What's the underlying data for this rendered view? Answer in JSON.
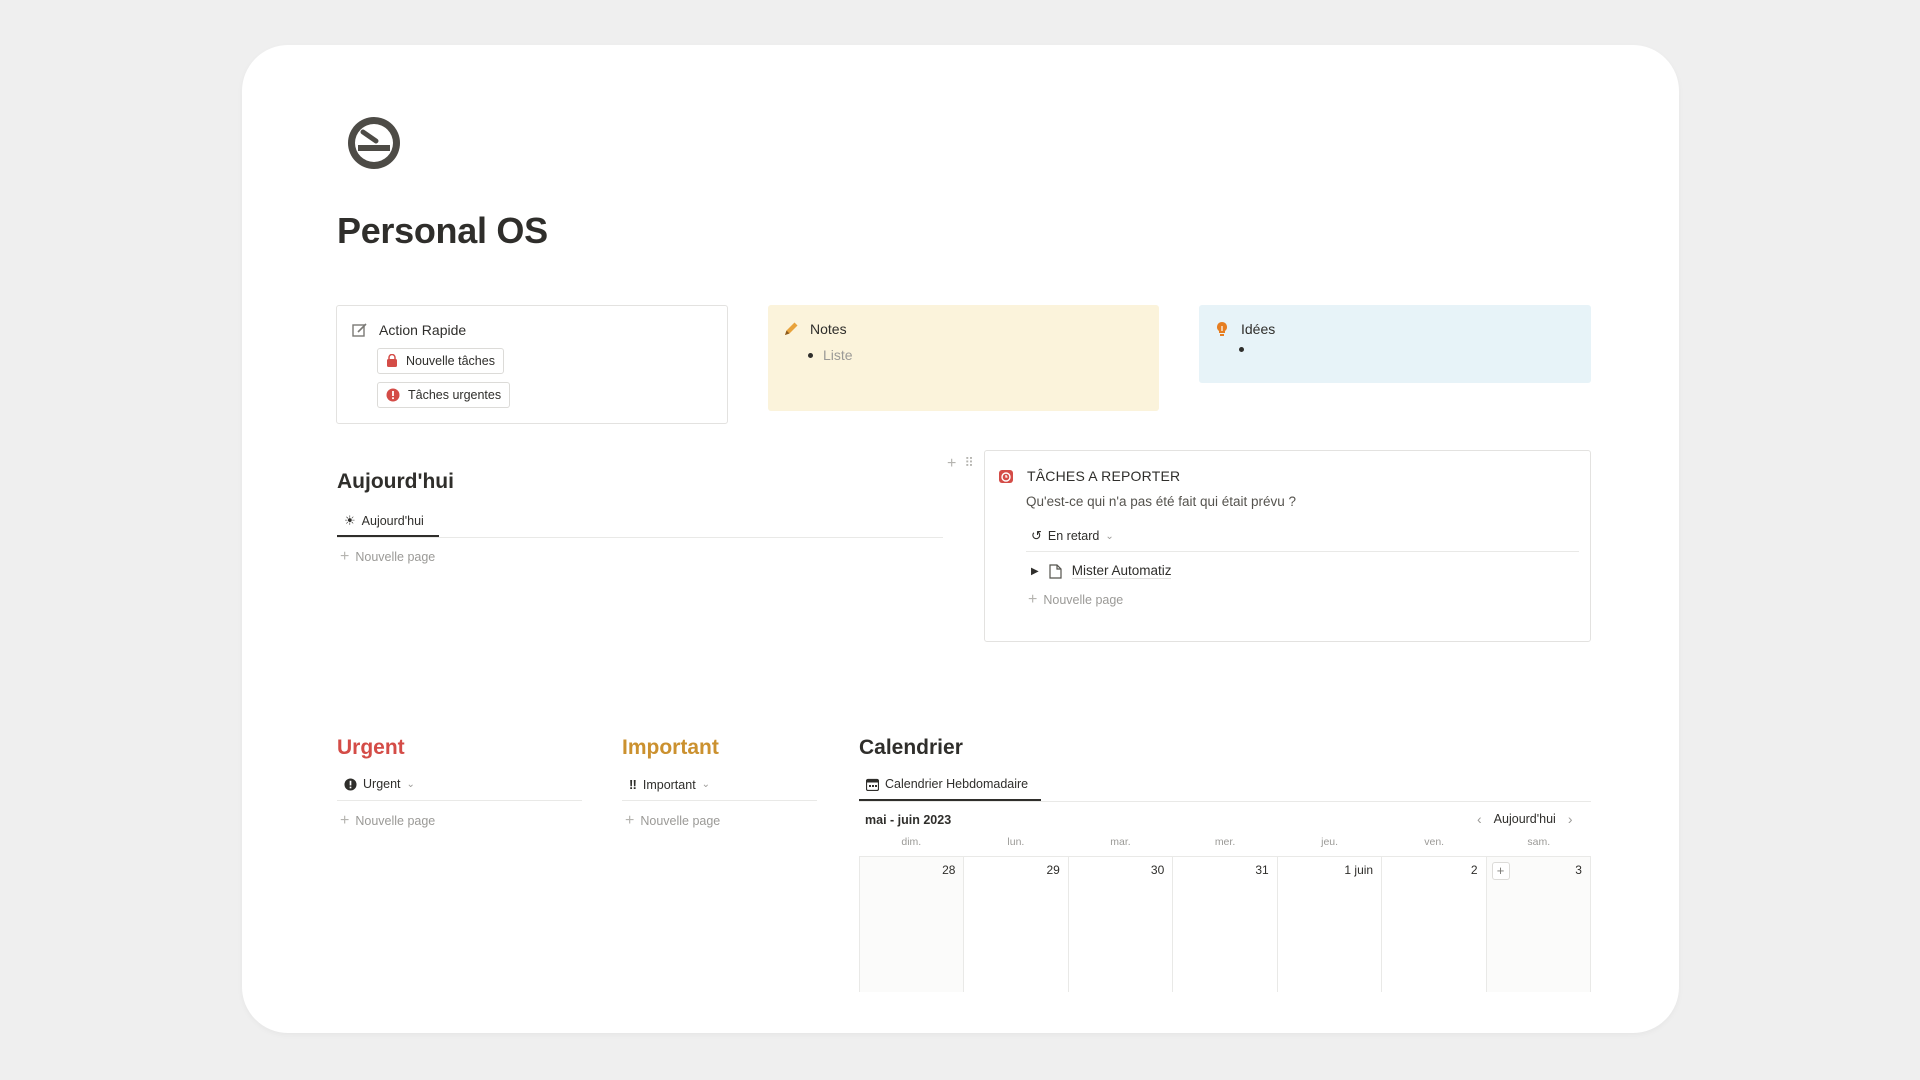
{
  "page": {
    "title": "Personal OS",
    "icon": "cigarette-no-smoking-icon"
  },
  "callouts": {
    "action": {
      "title": "Action Rapide",
      "icon": "edit-icon",
      "buttons": [
        {
          "label": "Nouvelle tâches",
          "icon": "lock-red-icon",
          "color": "#d44c47"
        },
        {
          "label": "Tâches urgentes",
          "icon": "alert-circle-red-icon",
          "color": "#d44c47"
        }
      ]
    },
    "notes": {
      "title": "Notes",
      "icon": "pencil-icon",
      "items": [
        "Liste"
      ],
      "bg": "#fbf3db"
    },
    "idees": {
      "title": "Idées",
      "icon": "lightbulb-icon",
      "bg": "#e7f3f8"
    }
  },
  "aujourdhui": {
    "heading": "Aujourd'hui",
    "tab": "Aujourd'hui",
    "new_page": "Nouvelle page"
  },
  "reporter": {
    "title": "TÂCHES A REPORTER",
    "subtitle": "Qu'est-ce qui n'a pas été fait qui était prévu ?",
    "view": "En retard",
    "item": "Mister Automatiz",
    "new_page": "Nouvelle page"
  },
  "urgent": {
    "heading": "Urgent",
    "view": "Urgent",
    "new_page": "Nouvelle page",
    "color": "#d44c47"
  },
  "important": {
    "heading": "Important",
    "view": "Important",
    "new_page": "Nouvelle page",
    "color": "#cb912f"
  },
  "calendrier": {
    "heading": "Calendrier",
    "tab": "Calendrier Hebdomadaire",
    "month": "mai - juin 2023",
    "today": "Aujourd'hui",
    "days": [
      "dim.",
      "lun.",
      "mar.",
      "mer.",
      "jeu.",
      "ven.",
      "sam."
    ],
    "dates": [
      "28",
      "29",
      "30",
      "31",
      "1 juin",
      "2",
      "3"
    ]
  }
}
